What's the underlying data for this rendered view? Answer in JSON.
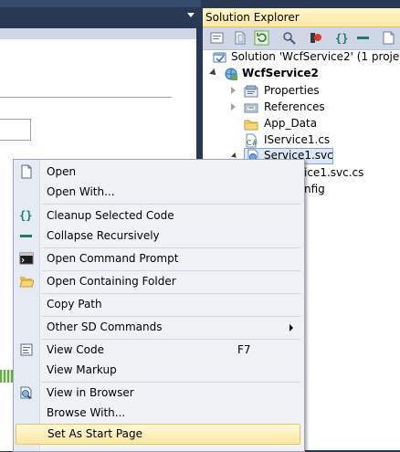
{
  "solution_explorer": {
    "title": "Solution Explorer",
    "toolbar_buttons": [
      {
        "icon": "properties-icon"
      },
      {
        "icon": "show-all-files-icon"
      },
      {
        "icon": "refresh-icon"
      },
      {
        "icon": "view-class-diagram-icon"
      },
      {
        "icon": "debug-icon"
      },
      {
        "icon": "braces-icon"
      },
      {
        "icon": "collapse-icon"
      },
      {
        "icon": "folder-view-icon"
      }
    ],
    "tree": {
      "solution": "Solution 'WcfService2' (1 project)",
      "project": "WcfService2",
      "properties": "Properties",
      "references": "References",
      "app_data": "App_Data",
      "iservice": "IService1.cs",
      "service_svc": "Service1.svc",
      "service_svc_cs": "ice1.svc.cs",
      "web_config": "nfig"
    }
  },
  "context_menu": {
    "items": [
      {
        "label": "Open",
        "icon": "open-icon",
        "shortcut": ""
      },
      {
        "label": "Open With...",
        "icon": "",
        "shortcut": ""
      },
      {
        "label": "Cleanup Selected Code",
        "icon": "braces-icon",
        "shortcut": ""
      },
      {
        "label": "Collapse Recursively",
        "icon": "collapse-icon",
        "shortcut": ""
      },
      {
        "label": "Open Command Prompt",
        "icon": "command-prompt-icon",
        "shortcut": ""
      },
      {
        "label": "Open Containing Folder",
        "icon": "folder-open-icon",
        "shortcut": ""
      },
      {
        "label": "Copy Path",
        "icon": "",
        "shortcut": ""
      },
      {
        "label": "Other SD Commands",
        "icon": "",
        "shortcut": "",
        "submenu": true
      },
      {
        "label": "View Code",
        "icon": "view-code-icon",
        "shortcut": "F7"
      },
      {
        "label": "View Markup",
        "icon": "",
        "shortcut": ""
      },
      {
        "label": "View in Browser",
        "icon": "browser-icon",
        "shortcut": ""
      },
      {
        "label": "Browse With...",
        "icon": "",
        "shortcut": ""
      },
      {
        "label": "Set As Start Page",
        "icon": "",
        "shortcut": "",
        "highlighted": true
      }
    ]
  },
  "colors": {
    "background": "#293955",
    "explorer_header": "#ffe8a6",
    "menu_background": "#f0f2f6",
    "menu_highlight": "#ffe7a2",
    "selected_row": "#dbe8f7"
  }
}
